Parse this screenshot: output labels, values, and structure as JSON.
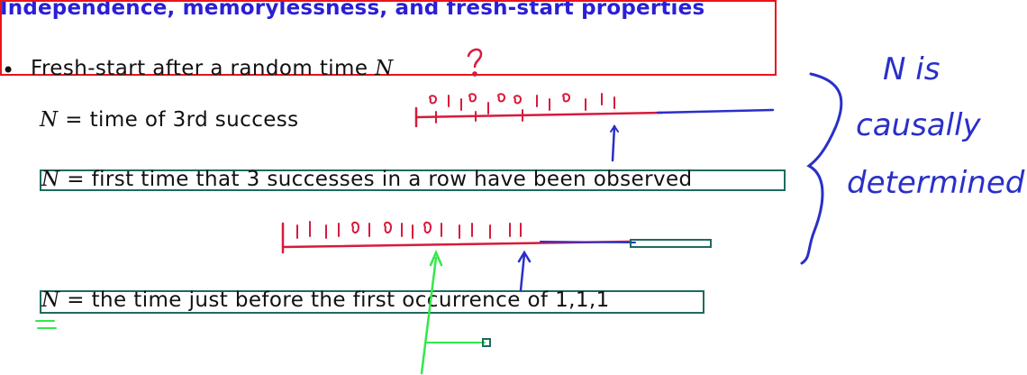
{
  "slide": {
    "title": "Independence, memorylessness, and fresh-start properties",
    "bullet": "•",
    "bullet_text": "Fresh-start after a random time",
    "var_n": "N",
    "lines": [
      {
        "var": "N",
        "rest": "= time of 3rd success"
      },
      {
        "var": "N",
        "rest": "= first time that 3 successes in a row have been observed"
      },
      {
        "var": "N",
        "rest": "= the time just before the first occurrence of 1,1,1"
      }
    ]
  },
  "annotations": {
    "question_mark": "?",
    "sequence_1": "1 0 1 1 0 1 0 1 1 0 1 1",
    "sequence_2": "1 1 1 1 0 1 0 1 1 0 1 1 1 1 1 1",
    "margin_note": [
      "N is",
      "causally",
      "determined"
    ]
  },
  "colors": {
    "title": "#2a1fd6",
    "title_box": "#e8141b",
    "box": "#1e6b5e",
    "red_ink": "#d81a3c",
    "blue_ink": "#2a2fc8",
    "green_ink": "#33e84a"
  }
}
